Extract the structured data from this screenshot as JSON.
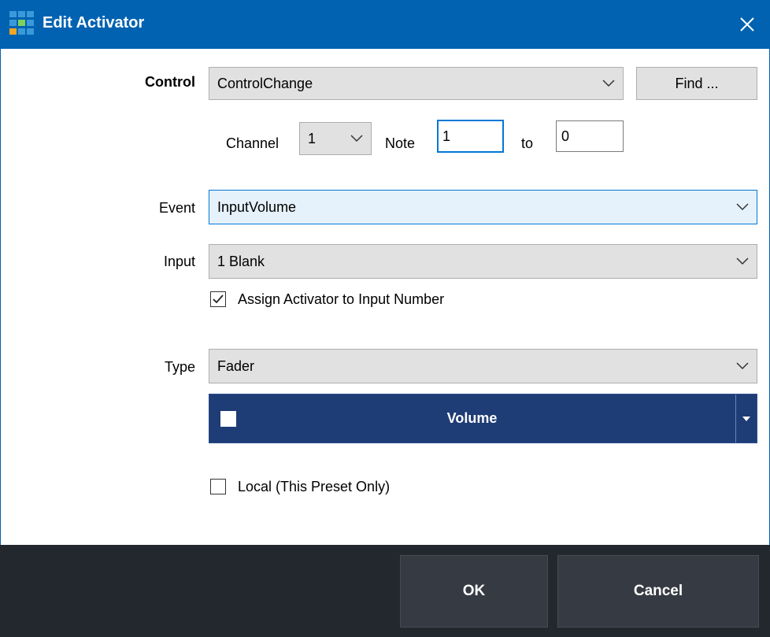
{
  "window": {
    "title": "Edit Activator",
    "colors": {
      "titlebar": "#0062b1",
      "footer": "#23272e",
      "accent_bar": "#1e3c75"
    }
  },
  "control": {
    "label": "Control",
    "value": "ControlChange",
    "find_button": "Find ..."
  },
  "channel": {
    "label": "Channel",
    "value": "1"
  },
  "note": {
    "label": "Note",
    "from_value": "1",
    "to_label": "to",
    "to_value": "0"
  },
  "event": {
    "label": "Event",
    "value": "InputVolume"
  },
  "input": {
    "label": "Input",
    "value": "1 Blank",
    "assign_checkbox_label": "Assign Activator to Input Number",
    "assign_checked": true
  },
  "type": {
    "label": "Type",
    "value": "Fader"
  },
  "action": {
    "label": "Volume",
    "swatch_color": "#ffffff"
  },
  "local": {
    "label": "Local (This Preset Only)",
    "checked": false
  },
  "footer": {
    "ok": "OK",
    "cancel": "Cancel"
  },
  "icons": [
    "app-grid-icon",
    "close-icon",
    "chevron-down-icon",
    "checkmark-icon",
    "caret-down-icon"
  ]
}
